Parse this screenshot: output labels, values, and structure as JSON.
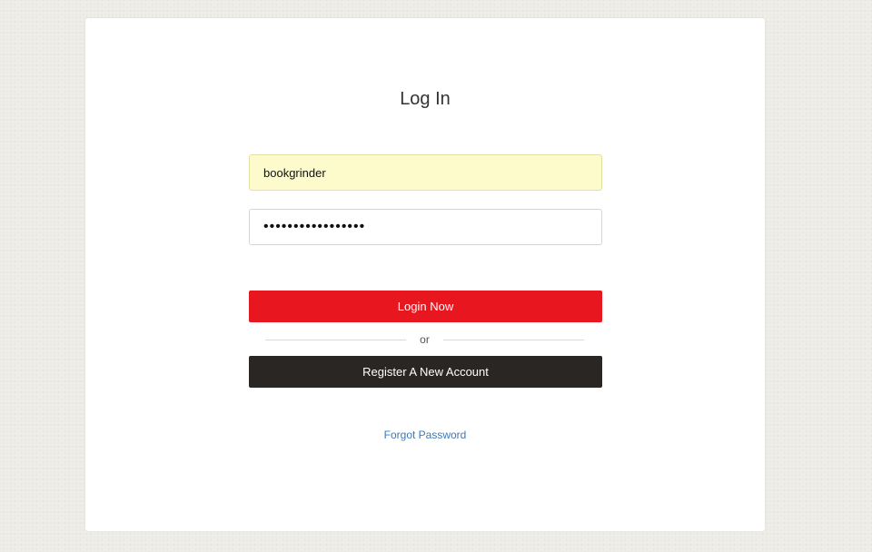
{
  "login_form": {
    "title": "Log In",
    "username_value": "bookgrinder",
    "password_value": "•••••••••••••••••",
    "login_label": "Login Now",
    "divider_text": "or",
    "register_label": "Register A New Account",
    "forgot_label": "Forgot Password"
  },
  "colors": {
    "login_button": "#e8161f",
    "register_button": "#2a2624",
    "autofill_field": "#fdfbcc",
    "link": "#3c7ab6",
    "page_background": "#ecebe6"
  }
}
